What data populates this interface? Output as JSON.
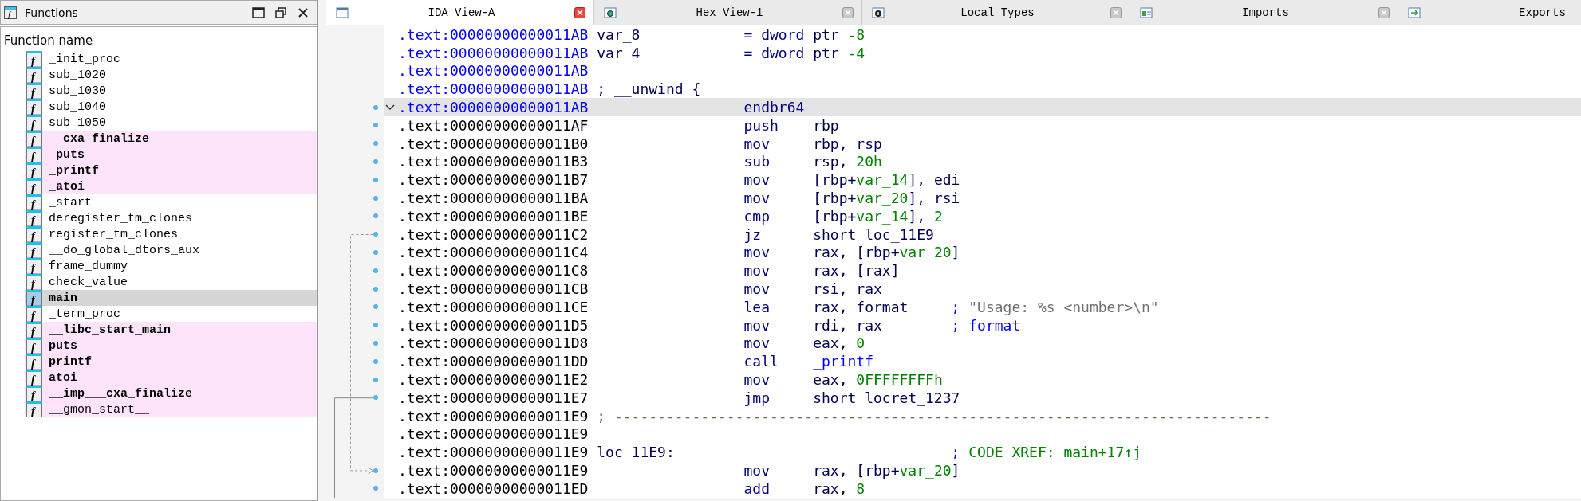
{
  "functions_panel": {
    "title_icon": "f",
    "title": "Functions",
    "column_header": "Function name",
    "items": [
      {
        "icon": "f",
        "name": "_init_proc",
        "kind": "regular",
        "selected": false
      },
      {
        "icon": "f",
        "name": "sub_1020",
        "kind": "regular",
        "selected": false
      },
      {
        "icon": "f",
        "name": "sub_1030",
        "kind": "regular",
        "selected": false
      },
      {
        "icon": "f",
        "name": "sub_1040",
        "kind": "regular",
        "selected": false
      },
      {
        "icon": "f",
        "name": "sub_1050",
        "kind": "regular",
        "selected": false
      },
      {
        "icon": "f",
        "name": "__cxa_finalize",
        "kind": "import",
        "selected": false
      },
      {
        "icon": "f",
        "name": "_puts",
        "kind": "import",
        "selected": false
      },
      {
        "icon": "f",
        "name": "_printf",
        "kind": "import",
        "selected": false
      },
      {
        "icon": "f",
        "name": "_atoi",
        "kind": "import",
        "selected": false
      },
      {
        "icon": "f",
        "name": "_start",
        "kind": "regular",
        "selected": false
      },
      {
        "icon": "f",
        "name": "deregister_tm_clones",
        "kind": "regular",
        "selected": false
      },
      {
        "icon": "f",
        "name": "register_tm_clones",
        "kind": "regular",
        "selected": false
      },
      {
        "icon": "f",
        "name": "__do_global_dtors_aux",
        "kind": "regular",
        "selected": false
      },
      {
        "icon": "f",
        "name": "frame_dummy",
        "kind": "regular",
        "selected": false
      },
      {
        "icon": "f",
        "name": "check_value",
        "kind": "regular",
        "selected": false
      },
      {
        "icon": "f",
        "name": "main",
        "kind": "regular",
        "selected": true
      },
      {
        "icon": "f",
        "name": "_term_proc",
        "kind": "regular",
        "selected": false
      },
      {
        "icon": "f",
        "name": "__libc_start_main",
        "kind": "import",
        "selected": false
      },
      {
        "icon": "f",
        "name": "puts",
        "kind": "import",
        "selected": false
      },
      {
        "icon": "f",
        "name": "printf",
        "kind": "import",
        "selected": false
      },
      {
        "icon": "f",
        "name": "atoi",
        "kind": "import",
        "selected": false
      },
      {
        "icon": "f",
        "name": "__imp___cxa_finalize",
        "kind": "import",
        "selected": false
      },
      {
        "icon": "f",
        "name": "__gmon_start__",
        "kind": "extern",
        "selected": false
      }
    ]
  },
  "tabs": [
    {
      "label": "IDA View-A",
      "kind": "disassembly",
      "selected": true,
      "closable": true
    },
    {
      "label": "Hex View-1",
      "kind": "hex",
      "selected": false,
      "closable": true
    },
    {
      "label": "Local Types",
      "kind": "types",
      "selected": false,
      "closable": true
    },
    {
      "label": "Imports",
      "kind": "imports",
      "selected": false,
      "closable": true
    },
    {
      "label": "Exports",
      "kind": "exports",
      "selected": false,
      "closable": false
    }
  ],
  "disassembly": {
    "lines": [
      {
        "address": ".text:00000000000011AB",
        "at_cursor": true,
        "selected": false,
        "dot": false,
        "label": "var_8",
        "mnemonic": "= dword",
        "operands": [
          {
            "text": "ptr ",
            "kind": "plain"
          },
          {
            "text": "-8",
            "kind": "num"
          }
        ]
      },
      {
        "address": ".text:00000000000011AB",
        "at_cursor": true,
        "selected": false,
        "dot": false,
        "label": "var_4",
        "mnemonic": "= dword",
        "operands": [
          {
            "text": "ptr ",
            "kind": "plain"
          },
          {
            "text": "-4",
            "kind": "num"
          }
        ]
      },
      {
        "address": ".text:00000000000011AB",
        "at_cursor": true,
        "selected": false,
        "dot": false
      },
      {
        "address": ".text:00000000000011AB",
        "at_cursor": true,
        "selected": false,
        "dot": false,
        "label": "; __unwind {"
      },
      {
        "address": ".text:00000000000011AB",
        "at_cursor": true,
        "selected": true,
        "dot": true,
        "collapsible": true,
        "mnemonic": "endbr64"
      },
      {
        "address": ".text:00000000000011AF",
        "at_cursor": false,
        "selected": false,
        "dot": true,
        "mnemonic": "push",
        "operands": [
          {
            "text": "rbp",
            "kind": "plain"
          }
        ]
      },
      {
        "address": ".text:00000000000011B0",
        "at_cursor": false,
        "selected": false,
        "dot": true,
        "mnemonic": "mov",
        "operands": [
          {
            "text": "rbp, rsp",
            "kind": "plain"
          }
        ]
      },
      {
        "address": ".text:00000000000011B3",
        "at_cursor": false,
        "selected": false,
        "dot": true,
        "mnemonic": "sub",
        "operands": [
          {
            "text": "rsp, ",
            "kind": "plain"
          },
          {
            "text": "20h",
            "kind": "num"
          }
        ]
      },
      {
        "address": ".text:00000000000011B7",
        "at_cursor": false,
        "selected": false,
        "dot": true,
        "mnemonic": "mov",
        "operands": [
          {
            "text": "[rbp+",
            "kind": "plain"
          },
          {
            "text": "var_14",
            "kind": "num"
          },
          {
            "text": "], edi",
            "kind": "plain"
          }
        ]
      },
      {
        "address": ".text:00000000000011BA",
        "at_cursor": false,
        "selected": false,
        "dot": true,
        "mnemonic": "mov",
        "operands": [
          {
            "text": "[rbp+",
            "kind": "plain"
          },
          {
            "text": "var_20",
            "kind": "num"
          },
          {
            "text": "], rsi",
            "kind": "plain"
          }
        ]
      },
      {
        "address": ".text:00000000000011BE",
        "at_cursor": false,
        "selected": false,
        "dot": true,
        "mnemonic": "cmp",
        "operands": [
          {
            "text": "[rbp+",
            "kind": "plain"
          },
          {
            "text": "var_14",
            "kind": "num"
          },
          {
            "text": "], ",
            "kind": "plain"
          },
          {
            "text": "2",
            "kind": "num"
          }
        ]
      },
      {
        "address": ".text:00000000000011C2",
        "at_cursor": false,
        "selected": false,
        "dot": true,
        "mnemonic": "jz",
        "operands": [
          {
            "text": "short loc_11E9",
            "kind": "plain"
          }
        ]
      },
      {
        "address": ".text:00000000000011C4",
        "at_cursor": false,
        "selected": false,
        "dot": true,
        "mnemonic": "mov",
        "operands": [
          {
            "text": "rax, [rbp+",
            "kind": "plain"
          },
          {
            "text": "var_20",
            "kind": "num"
          },
          {
            "text": "]",
            "kind": "plain"
          }
        ]
      },
      {
        "address": ".text:00000000000011C8",
        "at_cursor": false,
        "selected": false,
        "dot": true,
        "mnemonic": "mov",
        "operands": [
          {
            "text": "rax, [rax]",
            "kind": "plain"
          }
        ]
      },
      {
        "address": ".text:00000000000011CB",
        "at_cursor": false,
        "selected": false,
        "dot": true,
        "mnemonic": "mov",
        "operands": [
          {
            "text": "rsi, rax",
            "kind": "plain"
          }
        ]
      },
      {
        "address": ".text:00000000000011CE",
        "at_cursor": false,
        "selected": false,
        "dot": true,
        "mnemonic": "lea",
        "operands": [
          {
            "text": "rax, format",
            "kind": "plain"
          }
        ],
        "comment": [
          {
            "text": ";",
            "kind": "punct"
          },
          {
            "text": "\"Usage: %s <number>\\n\"",
            "kind": "string"
          }
        ]
      },
      {
        "address": ".text:00000000000011D5",
        "at_cursor": false,
        "selected": false,
        "dot": true,
        "mnemonic": "mov",
        "operands": [
          {
            "text": "rdi, rax",
            "kind": "plain"
          }
        ],
        "comment": [
          {
            "text": ";",
            "kind": "punct"
          },
          {
            "text": "format",
            "kind": "name"
          }
        ]
      },
      {
        "address": ".text:00000000000011D8",
        "at_cursor": false,
        "selected": false,
        "dot": true,
        "mnemonic": "mov",
        "operands": [
          {
            "text": "eax, ",
            "kind": "plain"
          },
          {
            "text": "0",
            "kind": "num"
          }
        ]
      },
      {
        "address": ".text:00000000000011DD",
        "at_cursor": false,
        "selected": false,
        "dot": true,
        "mnemonic": "call",
        "operands": [
          {
            "text": "_printf",
            "kind": "name"
          }
        ]
      },
      {
        "address": ".text:00000000000011E2",
        "at_cursor": false,
        "selected": false,
        "dot": true,
        "mnemonic": "mov",
        "operands": [
          {
            "text": "eax, ",
            "kind": "plain"
          },
          {
            "text": "0FFFFFFFFh",
            "kind": "num"
          }
        ]
      },
      {
        "address": ".text:00000000000011E7",
        "at_cursor": false,
        "selected": false,
        "dot": true,
        "mnemonic": "jmp",
        "operands": [
          {
            "text": "short locret_1237",
            "kind": "plain"
          }
        ]
      },
      {
        "address": ".text:00000000000011E9",
        "at_cursor": false,
        "selected": false,
        "dot": false,
        "separator": "; ----------------------------------------------------------------------------"
      },
      {
        "address": ".text:00000000000011E9",
        "at_cursor": false,
        "selected": false,
        "dot": false
      },
      {
        "address": ".text:00000000000011E9",
        "at_cursor": false,
        "selected": false,
        "dot": false,
        "label": "loc_11E9:",
        "comment": [
          {
            "text": ";",
            "kind": "punct"
          },
          {
            "text": "CODE XREF: main+17↑j",
            "kind": "xref"
          }
        ]
      },
      {
        "address": ".text:00000000000011E9",
        "at_cursor": false,
        "selected": false,
        "dot": true,
        "mnemonic": "mov",
        "operands": [
          {
            "text": "rax, [rbp+",
            "kind": "plain"
          },
          {
            "text": "var_20",
            "kind": "num"
          },
          {
            "text": "]",
            "kind": "plain"
          }
        ]
      },
      {
        "address": ".text:00000000000011ED",
        "at_cursor": false,
        "selected": false,
        "dot": true,
        "mnemonic": "add",
        "operands": [
          {
            "text": "rax, ",
            "kind": "plain"
          },
          {
            "text": "8",
            "kind": "num"
          }
        ]
      }
    ]
  }
}
